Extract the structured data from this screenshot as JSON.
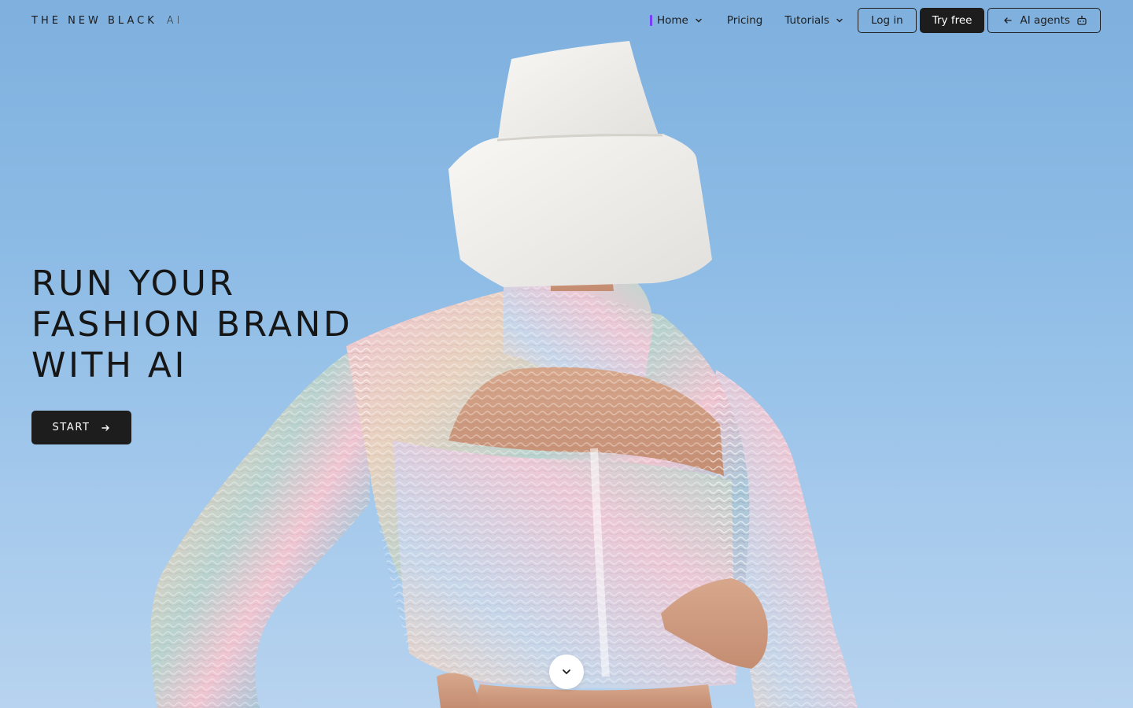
{
  "brand": {
    "logo_main": "THE NEW BLACK",
    "logo_suffix": "AI"
  },
  "nav": {
    "home": "Home",
    "pricing": "Pricing",
    "tutorials": "Tutorials",
    "login": "Log in",
    "try_free": "Try free",
    "ai_agents": "AI agents"
  },
  "hero": {
    "headline_line1": "RUN YOUR",
    "headline_line2": "FASHION BRAND",
    "headline_line3": "WITH AI",
    "start_label": "START"
  },
  "icons": {
    "home_dropdown": "chevron-down-icon",
    "tutorials_dropdown": "chevron-down-icon",
    "agents_arrow": "arrow-left-icon",
    "agents_bot": "robot-icon",
    "start_arrow": "arrow-right-icon",
    "scroll": "chevron-down-icon"
  },
  "colors": {
    "sky_top": "#7fb0de",
    "sky_bottom": "#b7d3ef",
    "dark": "#1d1d1d",
    "active_accent": "#7a3cff"
  }
}
